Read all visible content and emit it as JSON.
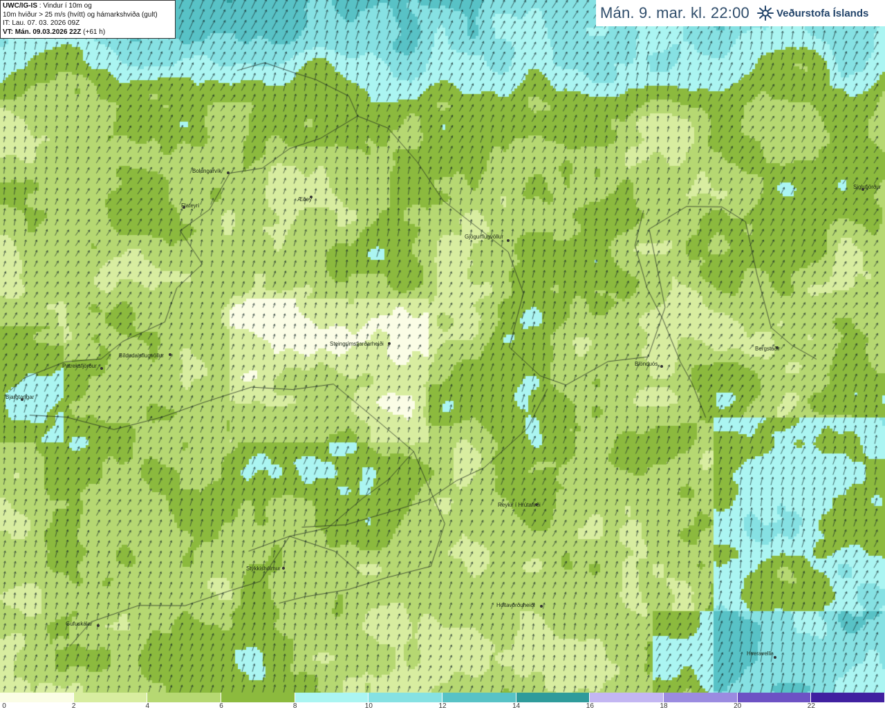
{
  "info": {
    "model": "UWC/IG-IS",
    "line1_rest": " : Vindur í 10m og",
    "line2": "10m hviður > 25 m/s (hvítt) og hámarkshviða (gult)",
    "line3": "IT: Lau. 07. 03. 2026 09Z",
    "line4_bold": "VT: Mán. 09.03.2026 22Z",
    "line4_rest": " (+61 h)"
  },
  "title": "Mán. 9. mar. kl. 22:00",
  "logo": {
    "icon": "vedurstofa-logo-icon",
    "text": "Veðurstofa Íslands"
  },
  "legend": {
    "colors": [
      "#fbfde6",
      "#d8eda0",
      "#b6d872",
      "#8cba3e",
      "#abf5f2",
      "#86e1e3",
      "#58c2c6",
      "#2f9b9b",
      "#c3b6f2",
      "#9b8be0",
      "#6d52c4",
      "#4020a0"
    ],
    "labels": [
      "0",
      "2",
      "4",
      "6",
      "8",
      "10",
      "12",
      "14",
      "16",
      "18",
      "20",
      "22"
    ]
  },
  "places": [
    {
      "name": "Bolungarvík"
    },
    {
      "name": "Flateyri"
    },
    {
      "name": "Æðey"
    },
    {
      "name": "Gjögurflugvöllur"
    },
    {
      "name": "Siglufjörður"
    },
    {
      "name": "Steingrímsfjarðarheiði"
    },
    {
      "name": "Bíldudalsflugvöllur"
    },
    {
      "name": "Patreksfjörður"
    },
    {
      "name": "Bjargtangar"
    },
    {
      "name": "Blönduós"
    },
    {
      "name": "Bergstaðir"
    },
    {
      "name": "Reykir í Hrútafirði"
    },
    {
      "name": "Stykkishólmur"
    },
    {
      "name": "Holtavörðuheiði"
    },
    {
      "name": "Gufuskálar"
    },
    {
      "name": "Hveravellir"
    }
  ]
}
